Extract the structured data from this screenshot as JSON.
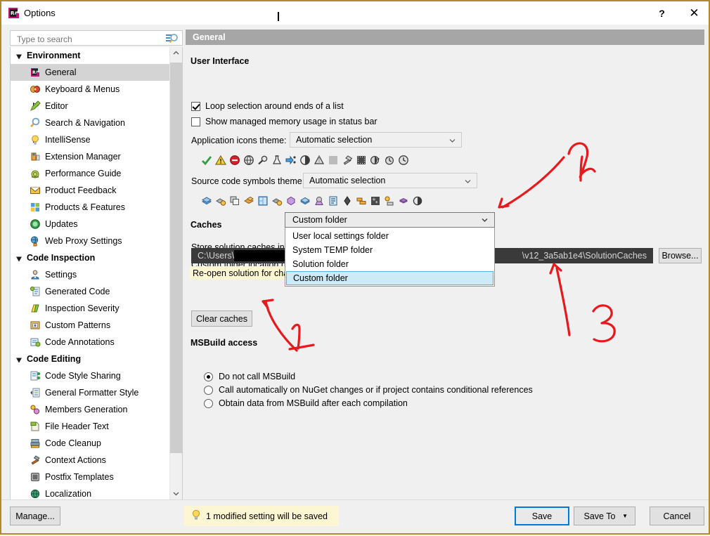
{
  "window": {
    "title": "Options",
    "icon": "resharper-icon",
    "help_label": "?",
    "close_label": "✕"
  },
  "search": {
    "placeholder": "Type to search",
    "value": "",
    "icon": "search-icon"
  },
  "tree": {
    "groups": [
      {
        "label": "Environment",
        "expanded": true,
        "items": [
          {
            "label": "General",
            "icon": "resharper-general-icon",
            "selected": true,
            "expandable": false
          },
          {
            "label": "Keyboard & Menus",
            "icon": "keyboard-icon",
            "selected": false,
            "expandable": false
          },
          {
            "label": "Editor",
            "icon": "pencil-icon",
            "selected": false,
            "expandable": true
          },
          {
            "label": "Search & Navigation",
            "icon": "magnifier-icon",
            "selected": false,
            "expandable": false
          },
          {
            "label": "IntelliSense",
            "icon": "lightbulb-icon",
            "selected": false,
            "expandable": true
          },
          {
            "label": "Extension Manager",
            "icon": "extension-icon",
            "selected": false,
            "expandable": false
          },
          {
            "label": "Performance Guide",
            "icon": "snail-icon",
            "selected": false,
            "expandable": false
          },
          {
            "label": "Product Feedback",
            "icon": "envelope-icon",
            "selected": false,
            "expandable": false
          },
          {
            "label": "Products & Features",
            "icon": "products-icon",
            "selected": false,
            "expandable": false
          },
          {
            "label": "Updates",
            "icon": "updates-icon",
            "selected": false,
            "expandable": false
          },
          {
            "label": "Web Proxy Settings",
            "icon": "globe-plug-icon",
            "selected": false,
            "expandable": false
          }
        ]
      },
      {
        "label": "Code Inspection",
        "expanded": true,
        "items": [
          {
            "label": "Settings",
            "icon": "inspector-icon",
            "selected": false,
            "expandable": false
          },
          {
            "label": "Generated Code",
            "icon": "generated-code-icon",
            "selected": false,
            "expandable": false
          },
          {
            "label": "Inspection Severity",
            "icon": "severity-icon",
            "selected": false,
            "expandable": false
          },
          {
            "label": "Custom Patterns",
            "icon": "patterns-icon",
            "selected": false,
            "expandable": false
          },
          {
            "label": "Code Annotations",
            "icon": "annotations-icon",
            "selected": false,
            "expandable": false
          }
        ]
      },
      {
        "label": "Code Editing",
        "expanded": true,
        "items": [
          {
            "label": "Code Style Sharing",
            "icon": "share-icon",
            "selected": false,
            "expandable": false
          },
          {
            "label": "General Formatter Style",
            "icon": "formatter-icon",
            "selected": false,
            "expandable": false
          },
          {
            "label": "Members Generation",
            "icon": "members-icon",
            "selected": false,
            "expandable": false
          },
          {
            "label": "File Header Text",
            "icon": "file-header-icon",
            "selected": false,
            "expandable": false
          },
          {
            "label": "Code Cleanup",
            "icon": "cleanup-icon",
            "selected": false,
            "expandable": false
          },
          {
            "label": "Context Actions",
            "icon": "hammer-icon",
            "selected": false,
            "expandable": false
          },
          {
            "label": "Postfix Templates",
            "icon": "postfix-icon",
            "selected": false,
            "expandable": false
          },
          {
            "label": "Localization",
            "icon": "localization-icon",
            "selected": false,
            "expandable": false
          }
        ]
      }
    ]
  },
  "page": {
    "header": "General",
    "user_interface": {
      "title": "User Interface",
      "loop_selection": {
        "label": "Loop selection around ends of a list",
        "checked": true
      },
      "show_memory": {
        "label": "Show managed memory usage in status bar",
        "checked": false
      },
      "app_icons_theme": {
        "label": "Application icons theme:",
        "value": "Automatic selection"
      },
      "app_icons_preview": [
        "checkmark-icon",
        "warning-icon",
        "error-icon",
        "globe-icon",
        "inspection-icon",
        "flask-icon",
        "refactor-icon",
        "analysis-icon",
        "cone-icon",
        "lightbulb-icon",
        "hammer-icon",
        "grid-icon",
        "bookmark-icon",
        "history-icon",
        "clock-icon"
      ],
      "symbols_theme": {
        "label": "Source code symbols theme:",
        "value": "Automatic selection"
      },
      "symbols_preview": [
        "namespace-icon",
        "class-icon",
        "copy-icon",
        "struct-icon",
        "interface-icon",
        "class2-icon",
        "enum-icon",
        "delegate-icon",
        "event-icon",
        "list-icon",
        "field-icon",
        "property-icon",
        "operator-icon",
        "method-icon",
        "constant-icon",
        "contrast-icon"
      ]
    },
    "caches": {
      "title": "Caches",
      "store_label": "Store solution caches in:",
      "store_value": "Custom folder",
      "store_options": [
        "User local settings folder",
        "System TEMP folder",
        "Solution folder",
        "Custom folder"
      ],
      "store_selected_index": 3,
      "custom_folder_label": "Custom folder location (p",
      "path_prefix": "C:\\Users\\",
      "path_suffix": "\\v12_3a5ab1e4\\SolutionCaches",
      "browse_label": "Browse...",
      "reopen_warning": "Re-open solution for cha",
      "clear_caches_label": "Clear caches"
    },
    "msbuild": {
      "title": "MSBuild access",
      "options": [
        {
          "label": "Do not call MSBuild",
          "selected": true
        },
        {
          "label": "Call automatically on NuGet changes or if project contains conditional references",
          "selected": false
        },
        {
          "label": "Obtain data from MSBuild after each compilation",
          "selected": false
        }
      ]
    }
  },
  "footer": {
    "manage_label": "Manage...",
    "status": "1 modified setting will be saved",
    "status_icon": "lightbulb-icon",
    "save_label": "Save",
    "save_to_label": "Save To",
    "save_to_arrow": "▼",
    "cancel_label": "Cancel"
  },
  "annotations": {
    "color": "#e8191c",
    "marks": [
      {
        "label": "1",
        "target": "clear-caches-button"
      },
      {
        "label": "2",
        "target": "store-solution-caches-dropdown"
      },
      {
        "label": "3",
        "target": "custom-folder-path-field"
      }
    ]
  },
  "colors": {
    "window_border": "#b08a2e",
    "header_bg": "#a6a6a6",
    "selection": "#cdeaf7",
    "warning_bg": "#fdf6d3",
    "accent": "#0078d7"
  }
}
